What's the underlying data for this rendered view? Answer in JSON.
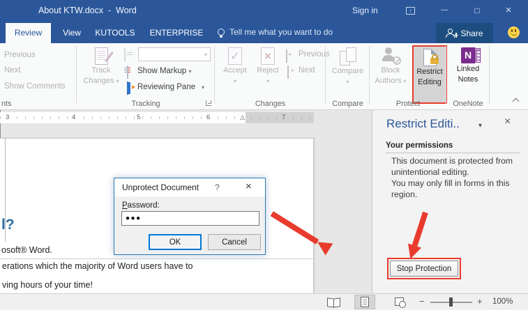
{
  "window": {
    "title": "About KTW.docx  -  Word",
    "sign_in": "Sign in"
  },
  "tabs": {
    "review": "Review",
    "view": "View",
    "kutools": "KUTOOLS",
    "enterprise": "ENTERPRISE",
    "tell_me": "Tell me what you want to do",
    "share": "Share"
  },
  "ribbon": {
    "comments": {
      "previous": "Previous",
      "next": "Next",
      "show_comments": "Show Comments",
      "group_label": "nts"
    },
    "tracking": {
      "track_line1": "Track",
      "track_line2": "Changes",
      "show_markup": "Show Markup",
      "reviewing_pane": "Reviewing Pane",
      "group_label": "Tracking"
    },
    "changes": {
      "accept": "Accept",
      "reject": "Reject",
      "previous": "Previous",
      "next": "Next",
      "group_label": "Changes"
    },
    "compare": {
      "compare": "Compare",
      "group_label": "Compare"
    },
    "protect": {
      "block_line1": "Block",
      "block_line2": "Authors",
      "restrict_line1": "Restrict",
      "restrict_line2": "Editing",
      "group_label": "Protect"
    },
    "onenote": {
      "linked_line1": "Linked",
      "linked_line2": "Notes",
      "letter": "N",
      "group_label": "OneNote"
    }
  },
  "ruler": {
    "marks": [
      "3",
      "4",
      "5",
      "6",
      "7"
    ]
  },
  "document": {
    "heading": "l?",
    "line_1": "osoft® Word.",
    "line_2": "erations which the majority of Word users have to",
    "line_3": "ving hours of your time!"
  },
  "dialog": {
    "title": "Unprotect Document",
    "help": "?",
    "close": "×",
    "password_label_key": "P",
    "password_label_rest": "assword:",
    "password_value": "●●●",
    "ok": "OK",
    "cancel": "Cancel"
  },
  "pane": {
    "title": "Restrict Editi..",
    "close": "×",
    "permissions_heading": "Your permissions",
    "paragraph_1": "This document is protected from unintentional editing.",
    "paragraph_2": "You may only fill in forms in this region.",
    "stop_protection": "Stop Protection"
  },
  "status": {
    "zoom_out": "−",
    "zoom_in": "+",
    "zoom_level": "100%"
  },
  "icons": {
    "dropdown": "▾",
    "up_arrow": "↑",
    "minimize": "—",
    "maximize": "□",
    "close": "×",
    "check": "✓",
    "reject_cross": "×",
    "ruler_indent_marker": "△"
  },
  "colors": {
    "titlebar_blue": "#2b579a",
    "annotation_red": "#e93b2d",
    "pane_title_blue": "#2b579a",
    "document_heading_blue": "#2e6da4",
    "onenote_purple": "#7b2d8e",
    "lock_gold": "#e2b13c",
    "smiley_yellow": "#ffd34d"
  }
}
